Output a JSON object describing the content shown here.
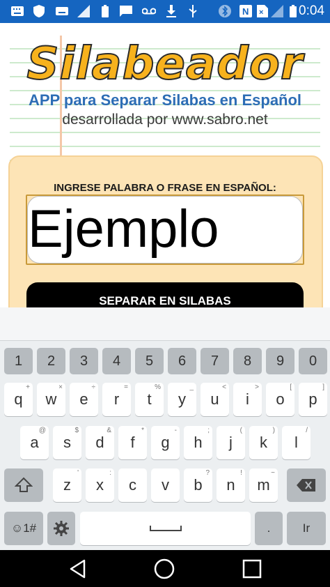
{
  "status_bar": {
    "time": "0:04",
    "bg_color": "#1565c0",
    "icons": [
      "keyboard-icon",
      "shield-icon",
      "keyboard-icon",
      "signal-icon",
      "battery-icon",
      "message-icon",
      "voicemail-icon",
      "download-icon",
      "usb-icon",
      "bluetooth-icon",
      "nfc-icon",
      "no-sim-icon",
      "cell-signal-icon",
      "battery-full-icon"
    ]
  },
  "app": {
    "logo": "Silabeador",
    "tagline": "APP para Separar Silabas en Español",
    "developer": "desarrollada por www.sabro.net",
    "input_label": "INGRESE PALABRA O FRASE EN ESPAÑOL:",
    "input_value": "Ejemplo",
    "button_label": "SEPARAR EN SILABAS"
  },
  "keyboard": {
    "number_row": [
      "1",
      "2",
      "3",
      "4",
      "5",
      "6",
      "7",
      "8",
      "9",
      "0"
    ],
    "row1": [
      {
        "k": "q",
        "h": "+"
      },
      {
        "k": "w",
        "h": "×"
      },
      {
        "k": "e",
        "h": "÷"
      },
      {
        "k": "r",
        "h": "="
      },
      {
        "k": "t",
        "h": "%"
      },
      {
        "k": "y",
        "h": "_"
      },
      {
        "k": "u",
        "h": "<"
      },
      {
        "k": "i",
        "h": ">"
      },
      {
        "k": "o",
        "h": "["
      },
      {
        "k": "p",
        "h": "]"
      }
    ],
    "row2": [
      {
        "k": "a",
        "h": "@"
      },
      {
        "k": "s",
        "h": "$"
      },
      {
        "k": "d",
        "h": "&"
      },
      {
        "k": "f",
        "h": "*"
      },
      {
        "k": "g",
        "h": "-"
      },
      {
        "k": "h",
        "h": ";"
      },
      {
        "k": "j",
        "h": "("
      },
      {
        "k": "k",
        "h": ")"
      },
      {
        "k": "l",
        "h": "/"
      }
    ],
    "row3": [
      {
        "k": "z",
        "h": "'"
      },
      {
        "k": "x",
        "h": ":"
      },
      {
        "k": "c",
        "h": ""
      },
      {
        "k": "v",
        "h": ""
      },
      {
        "k": "b",
        "h": "?"
      },
      {
        "k": "n",
        "h": "!"
      },
      {
        "k": "m",
        "h": "~"
      }
    ],
    "symbols_label": "☺1#",
    "period": ".",
    "enter_label": "Ir"
  },
  "nav": {
    "back": "back-icon",
    "home": "home-icon",
    "recents": "recents-icon"
  }
}
